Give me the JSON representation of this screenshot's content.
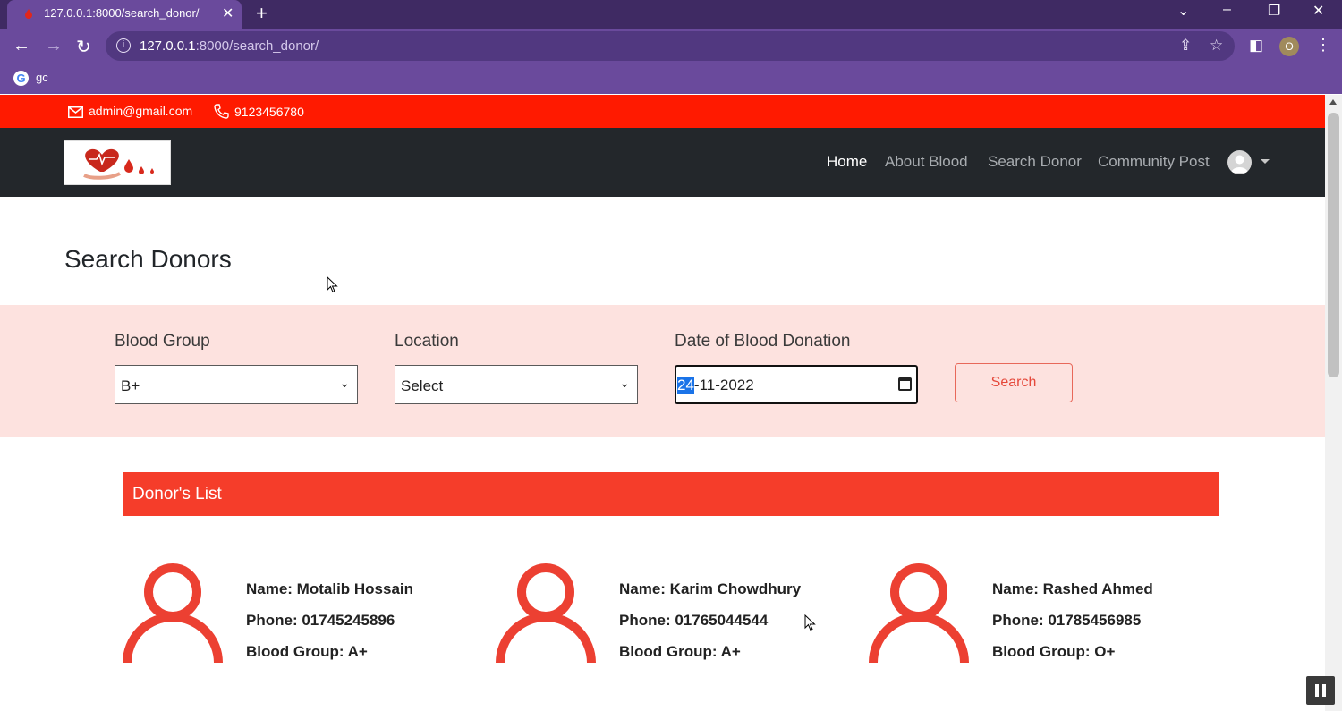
{
  "browser": {
    "tab_title": "127.0.0.1:8000/search_donor/",
    "url_host": "127.0.0.1",
    "url_path": ":8000/search_donor/",
    "bookmark_label": "gc",
    "profile_initial": "O"
  },
  "topbar": {
    "email": "admin@gmail.com",
    "phone": "9123456780"
  },
  "nav": {
    "items": [
      "Home",
      "About Blood",
      "Search Donor",
      "Community Post"
    ]
  },
  "page": {
    "title": "Search Donors"
  },
  "search": {
    "blood_group_label": "Blood Group",
    "blood_group_value": "B+",
    "location_label": "Location",
    "location_value": "Select",
    "date_label": "Date of Blood Donation",
    "date_day": "24",
    "date_rest": "-11-2022",
    "button_label": "Search"
  },
  "donor_list": {
    "header": "Donor's List",
    "donors": [
      {
        "name": "Name: Motalib Hossain",
        "phone": "Phone: 01745245896",
        "blood": "Blood Group: A+"
      },
      {
        "name": "Name: Karim Chowdhury",
        "phone": "Phone: 01765044544",
        "blood": "Blood Group: A+"
      },
      {
        "name": "Name: Rashed Ahmed",
        "phone": "Phone: 01785456985",
        "blood": "Blood Group: O+"
      }
    ]
  },
  "colors": {
    "browser_chrome": "#6a4a9c",
    "topbar_red": "#ff1a00",
    "navbar_dark": "#23272b",
    "panel_pink": "#fde2df",
    "accent_red": "#f53d2a"
  }
}
